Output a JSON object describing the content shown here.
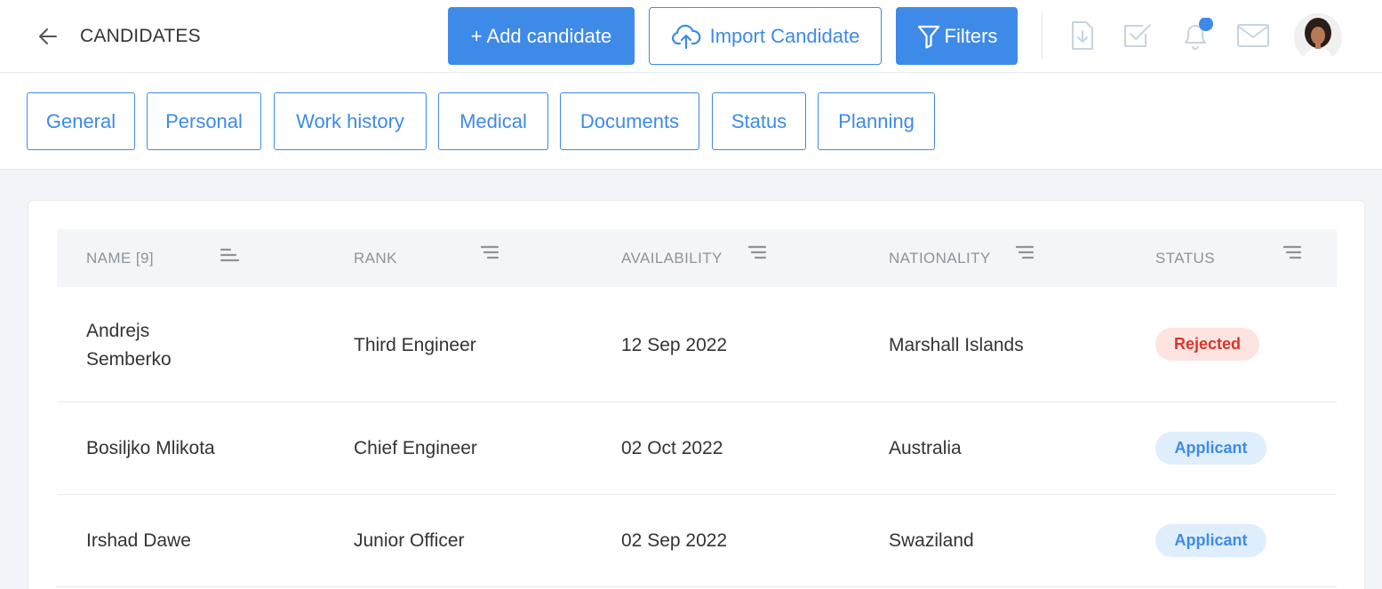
{
  "header": {
    "title": "CANDIDATES",
    "add_label": "+ Add candidate",
    "import_label": "Import Candidate",
    "filters_label": "Filters"
  },
  "tabs": [
    "General",
    "Personal",
    "Work history",
    "Medical",
    "Documents",
    "Status",
    "Planning"
  ],
  "table": {
    "columns": [
      "NAME [9]",
      "RANK",
      "AVAILABILITY",
      "NATIONALITY",
      "STATUS"
    ],
    "rows": [
      {
        "name_line1": "Andrejs",
        "name_line2": "Semberko",
        "rank": "Third Engineer",
        "availability": "12 Sep 2022",
        "nationality": "Marshall Islands",
        "status": "Rejected"
      },
      {
        "name_line1": "Bosiljko Mlikota",
        "name_line2": "",
        "rank": "Chief Engineer",
        "availability": "02 Oct 2022",
        "nationality": "Australia",
        "status": "Applicant"
      },
      {
        "name_line1": "Irshad Dawe",
        "name_line2": "",
        "rank": "Junior Officer",
        "availability": "02 Sep 2022",
        "nationality": "Swaziland",
        "status": "Applicant"
      }
    ]
  },
  "icons": [
    "back-arrow-icon",
    "cloud-upload-icon",
    "filter-icon",
    "download-icon",
    "checkbox-icon",
    "bell-icon",
    "mail-icon",
    "sort-icon"
  ],
  "colors": {
    "accent": "#3e8ae8",
    "rejected_bg": "#fde4e1",
    "rejected_text": "#d9362b",
    "applicant_bg": "#dfeefc",
    "notification_dot": "#3e8ae8"
  }
}
